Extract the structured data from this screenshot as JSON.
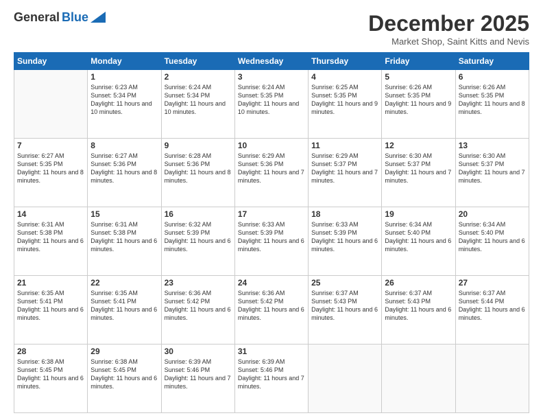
{
  "header": {
    "logo_general": "General",
    "logo_blue": "Blue",
    "month_title": "December 2025",
    "location": "Market Shop, Saint Kitts and Nevis"
  },
  "weekdays": [
    "Sunday",
    "Monday",
    "Tuesday",
    "Wednesday",
    "Thursday",
    "Friday",
    "Saturday"
  ],
  "rows": [
    [
      {
        "day": "",
        "sunrise": "",
        "sunset": "",
        "daylight": ""
      },
      {
        "day": "1",
        "sunrise": "Sunrise: 6:23 AM",
        "sunset": "Sunset: 5:34 PM",
        "daylight": "Daylight: 11 hours and 10 minutes."
      },
      {
        "day": "2",
        "sunrise": "Sunrise: 6:24 AM",
        "sunset": "Sunset: 5:34 PM",
        "daylight": "Daylight: 11 hours and 10 minutes."
      },
      {
        "day": "3",
        "sunrise": "Sunrise: 6:24 AM",
        "sunset": "Sunset: 5:35 PM",
        "daylight": "Daylight: 11 hours and 10 minutes."
      },
      {
        "day": "4",
        "sunrise": "Sunrise: 6:25 AM",
        "sunset": "Sunset: 5:35 PM",
        "daylight": "Daylight: 11 hours and 9 minutes."
      },
      {
        "day": "5",
        "sunrise": "Sunrise: 6:26 AM",
        "sunset": "Sunset: 5:35 PM",
        "daylight": "Daylight: 11 hours and 9 minutes."
      },
      {
        "day": "6",
        "sunrise": "Sunrise: 6:26 AM",
        "sunset": "Sunset: 5:35 PM",
        "daylight": "Daylight: 11 hours and 8 minutes."
      }
    ],
    [
      {
        "day": "7",
        "sunrise": "Sunrise: 6:27 AM",
        "sunset": "Sunset: 5:35 PM",
        "daylight": "Daylight: 11 hours and 8 minutes."
      },
      {
        "day": "8",
        "sunrise": "Sunrise: 6:27 AM",
        "sunset": "Sunset: 5:36 PM",
        "daylight": "Daylight: 11 hours and 8 minutes."
      },
      {
        "day": "9",
        "sunrise": "Sunrise: 6:28 AM",
        "sunset": "Sunset: 5:36 PM",
        "daylight": "Daylight: 11 hours and 8 minutes."
      },
      {
        "day": "10",
        "sunrise": "Sunrise: 6:29 AM",
        "sunset": "Sunset: 5:36 PM",
        "daylight": "Daylight: 11 hours and 7 minutes."
      },
      {
        "day": "11",
        "sunrise": "Sunrise: 6:29 AM",
        "sunset": "Sunset: 5:37 PM",
        "daylight": "Daylight: 11 hours and 7 minutes."
      },
      {
        "day": "12",
        "sunrise": "Sunrise: 6:30 AM",
        "sunset": "Sunset: 5:37 PM",
        "daylight": "Daylight: 11 hours and 7 minutes."
      },
      {
        "day": "13",
        "sunrise": "Sunrise: 6:30 AM",
        "sunset": "Sunset: 5:37 PM",
        "daylight": "Daylight: 11 hours and 7 minutes."
      }
    ],
    [
      {
        "day": "14",
        "sunrise": "Sunrise: 6:31 AM",
        "sunset": "Sunset: 5:38 PM",
        "daylight": "Daylight: 11 hours and 6 minutes."
      },
      {
        "day": "15",
        "sunrise": "Sunrise: 6:31 AM",
        "sunset": "Sunset: 5:38 PM",
        "daylight": "Daylight: 11 hours and 6 minutes."
      },
      {
        "day": "16",
        "sunrise": "Sunrise: 6:32 AM",
        "sunset": "Sunset: 5:39 PM",
        "daylight": "Daylight: 11 hours and 6 minutes."
      },
      {
        "day": "17",
        "sunrise": "Sunrise: 6:33 AM",
        "sunset": "Sunset: 5:39 PM",
        "daylight": "Daylight: 11 hours and 6 minutes."
      },
      {
        "day": "18",
        "sunrise": "Sunrise: 6:33 AM",
        "sunset": "Sunset: 5:39 PM",
        "daylight": "Daylight: 11 hours and 6 minutes."
      },
      {
        "day": "19",
        "sunrise": "Sunrise: 6:34 AM",
        "sunset": "Sunset: 5:40 PM",
        "daylight": "Daylight: 11 hours and 6 minutes."
      },
      {
        "day": "20",
        "sunrise": "Sunrise: 6:34 AM",
        "sunset": "Sunset: 5:40 PM",
        "daylight": "Daylight: 11 hours and 6 minutes."
      }
    ],
    [
      {
        "day": "21",
        "sunrise": "Sunrise: 6:35 AM",
        "sunset": "Sunset: 5:41 PM",
        "daylight": "Daylight: 11 hours and 6 minutes."
      },
      {
        "day": "22",
        "sunrise": "Sunrise: 6:35 AM",
        "sunset": "Sunset: 5:41 PM",
        "daylight": "Daylight: 11 hours and 6 minutes."
      },
      {
        "day": "23",
        "sunrise": "Sunrise: 6:36 AM",
        "sunset": "Sunset: 5:42 PM",
        "daylight": "Daylight: 11 hours and 6 minutes."
      },
      {
        "day": "24",
        "sunrise": "Sunrise: 6:36 AM",
        "sunset": "Sunset: 5:42 PM",
        "daylight": "Daylight: 11 hours and 6 minutes."
      },
      {
        "day": "25",
        "sunrise": "Sunrise: 6:37 AM",
        "sunset": "Sunset: 5:43 PM",
        "daylight": "Daylight: 11 hours and 6 minutes."
      },
      {
        "day": "26",
        "sunrise": "Sunrise: 6:37 AM",
        "sunset": "Sunset: 5:43 PM",
        "daylight": "Daylight: 11 hours and 6 minutes."
      },
      {
        "day": "27",
        "sunrise": "Sunrise: 6:37 AM",
        "sunset": "Sunset: 5:44 PM",
        "daylight": "Daylight: 11 hours and 6 minutes."
      }
    ],
    [
      {
        "day": "28",
        "sunrise": "Sunrise: 6:38 AM",
        "sunset": "Sunset: 5:45 PM",
        "daylight": "Daylight: 11 hours and 6 minutes."
      },
      {
        "day": "29",
        "sunrise": "Sunrise: 6:38 AM",
        "sunset": "Sunset: 5:45 PM",
        "daylight": "Daylight: 11 hours and 6 minutes."
      },
      {
        "day": "30",
        "sunrise": "Sunrise: 6:39 AM",
        "sunset": "Sunset: 5:46 PM",
        "daylight": "Daylight: 11 hours and 7 minutes."
      },
      {
        "day": "31",
        "sunrise": "Sunrise: 6:39 AM",
        "sunset": "Sunset: 5:46 PM",
        "daylight": "Daylight: 11 hours and 7 minutes."
      },
      {
        "day": "",
        "sunrise": "",
        "sunset": "",
        "daylight": ""
      },
      {
        "day": "",
        "sunrise": "",
        "sunset": "",
        "daylight": ""
      },
      {
        "day": "",
        "sunrise": "",
        "sunset": "",
        "daylight": ""
      }
    ]
  ]
}
